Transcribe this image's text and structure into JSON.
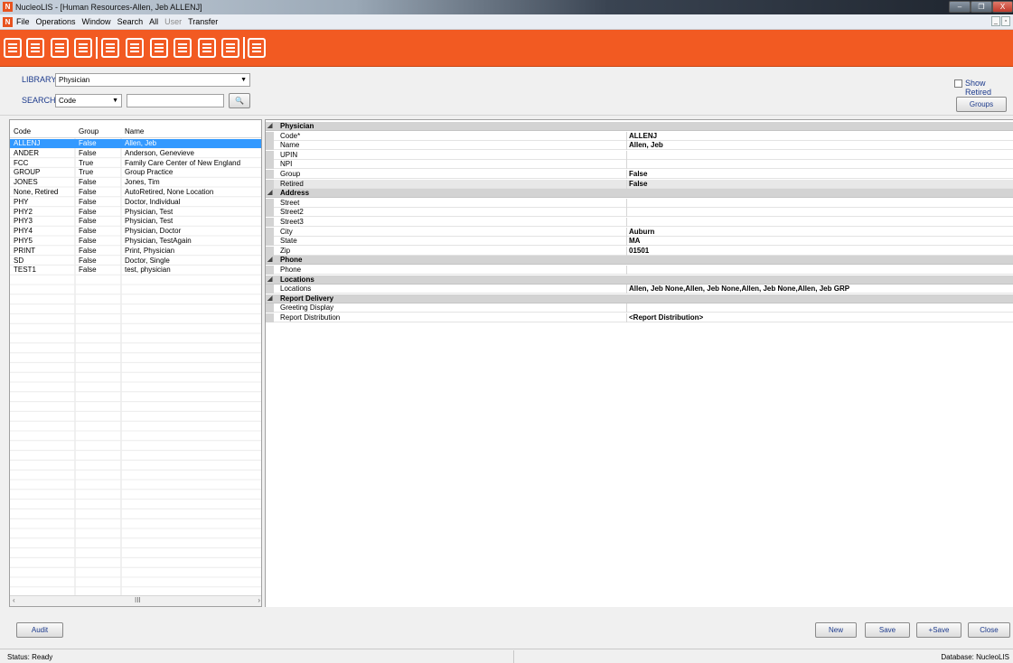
{
  "window": {
    "title": "NucleoLIS - [Human Resources-Allen, Jeb ALLENJ]",
    "min_glyph": "–",
    "max_glyph": "❐",
    "close_glyph": "X"
  },
  "menu": {
    "items": [
      "File",
      "Operations",
      "Window",
      "Search",
      "All",
      "User",
      "Transfer"
    ],
    "mdi_min": "_",
    "mdi_restore": "▫"
  },
  "toolbar": {
    "icons": [
      "new-test-icon",
      "dna-icon",
      "barcode-grid-icon",
      "printer-icon",
      "reports-icon",
      "barcode-icon",
      "document-icon",
      "user-search-icon",
      "certificate-icon",
      "tools-icon",
      "export-icon"
    ]
  },
  "search": {
    "library_label": "LIBRARY",
    "library_value": "Physician",
    "search_label": "SEARCH",
    "search_field": "Code",
    "search_text": "",
    "find_glyph": "🔍",
    "show_retired_label": "Show Retired",
    "groups_label": "Groups"
  },
  "list": {
    "headers": {
      "code": "Code",
      "group": "Group",
      "name": "Name"
    },
    "rows": [
      {
        "code": "ALLENJ",
        "group": "False",
        "name": "Allen, Jeb"
      },
      {
        "code": "ANDER",
        "group": "False",
        "name": "Anderson, Genevieve"
      },
      {
        "code": "FCC",
        "group": "True",
        "name": "Family Care Center of New England"
      },
      {
        "code": "GROUP",
        "group": "True",
        "name": "Group Practice"
      },
      {
        "code": "JONES",
        "group": "False",
        "name": "Jones, Tim"
      },
      {
        "code": "None, Retired",
        "group": "False",
        "name": "AutoRetired, None Location"
      },
      {
        "code": "PHY",
        "group": "False",
        "name": "Doctor, Individual"
      },
      {
        "code": "PHY2",
        "group": "False",
        "name": "Physician, Test"
      },
      {
        "code": "PHY3",
        "group": "False",
        "name": "Physician, Test"
      },
      {
        "code": "PHY4",
        "group": "False",
        "name": "Physician, Doctor"
      },
      {
        "code": "PHY5",
        "group": "False",
        "name": "Physician, TestAgain"
      },
      {
        "code": "PRINT",
        "group": "False",
        "name": "Print, Physician"
      },
      {
        "code": "SD",
        "group": "False",
        "name": "Doctor, Single"
      },
      {
        "code": "TEST1",
        "group": "False",
        "name": "test, physician"
      }
    ],
    "selected_index": 0,
    "scroll_left": "‹",
    "scroll_thumb": "III",
    "scroll_right": "›"
  },
  "properties": {
    "sections": [
      {
        "title": "Physician",
        "rows": [
          {
            "name": "Code*",
            "value": "ALLENJ"
          },
          {
            "name": "Name",
            "value": "Allen, Jeb"
          },
          {
            "name": "UPIN",
            "value": ""
          },
          {
            "name": "NPI",
            "value": ""
          },
          {
            "name": "Group",
            "value": "False"
          },
          {
            "name": "Retired",
            "value": "False"
          }
        ]
      },
      {
        "title": "Address",
        "rows": [
          {
            "name": "Street",
            "value": ""
          },
          {
            "name": "Street2",
            "value": ""
          },
          {
            "name": "Street3",
            "value": ""
          },
          {
            "name": "City",
            "value": "Auburn"
          },
          {
            "name": "State",
            "value": "MA"
          },
          {
            "name": "Zip",
            "value": "01501"
          }
        ]
      },
      {
        "title": "Phone",
        "rows": [
          {
            "name": "Phone",
            "value": ""
          }
        ]
      },
      {
        "title": "Locations",
        "rows": [
          {
            "name": "Locations",
            "value": "Allen, Jeb None,Allen, Jeb None,Allen, Jeb None,Allen, Jeb GRP"
          }
        ]
      },
      {
        "title": "Report Delivery",
        "rows": [
          {
            "name": "Greeting Display",
            "value": ""
          },
          {
            "name": "Report Distribution",
            "value": "<Report Distribution>"
          }
        ]
      }
    ],
    "expander_glyph": "◢"
  },
  "actions": {
    "audit": "Audit",
    "new": "New",
    "save": "Save",
    "plus_save": "+Save",
    "close": "Close"
  },
  "status": {
    "left": "Status: Ready",
    "right": "Database: NucleoLIS"
  }
}
